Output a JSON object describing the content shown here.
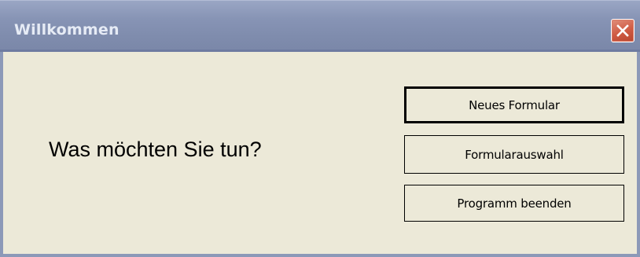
{
  "window": {
    "title": "Willkommen",
    "close_icon": "close-icon"
  },
  "main": {
    "question": "Was möchten Sie tun?"
  },
  "buttons": {
    "new_form": "Neues Formular",
    "form_selection": "Formularauswahl",
    "exit_program": "Programm beenden"
  },
  "colors": {
    "titlebar": "#8794b5",
    "window_bg": "#ece9d8",
    "close_button": "#cf5a43"
  }
}
